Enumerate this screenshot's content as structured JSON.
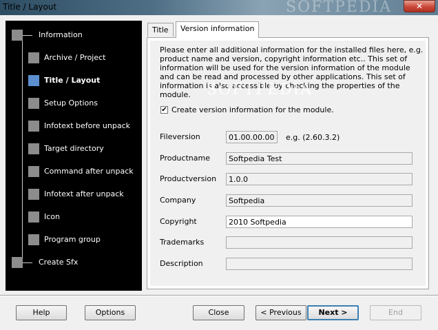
{
  "window": {
    "title": "Title / Layout",
    "watermark": "SOFTPEDIA",
    "close_glyph": "✕"
  },
  "nav": {
    "items": [
      {
        "label": "Information"
      },
      {
        "label": "Archive / Project"
      },
      {
        "label": "Title / Layout"
      },
      {
        "label": "Setup Options"
      },
      {
        "label": "Infotext before unpack"
      },
      {
        "label": "Target directory"
      },
      {
        "label": "Command after unpack"
      },
      {
        "label": "Infotext after unpack"
      },
      {
        "label": "Icon"
      },
      {
        "label": "Program group"
      },
      {
        "label": "Create Sfx"
      }
    ]
  },
  "tabs": [
    {
      "label": "Title"
    },
    {
      "label": "Version information"
    }
  ],
  "panel": {
    "description": "Please enter all additional information for the installed files here, e.g. product name and version, copyright information etc.. This set of information will be used for the version information of the module and can be read and processed by other applications. This set of information is also accessible by checking the properties of the module.",
    "watermark": "SOFTPEDIA",
    "checkbox": {
      "label": "Create version information for the module.",
      "checked": true,
      "mark": "✔"
    },
    "fields": {
      "fileversion": {
        "label": "Fileversion",
        "value": "01.00.00.00",
        "hint": "e.g. (2.60.3.2)"
      },
      "productname": {
        "label": "Productname",
        "value": "Softpedia Test"
      },
      "productversion": {
        "label": "Productversion",
        "value": "1.0.0"
      },
      "company": {
        "label": "Company",
        "value": "Softpedia"
      },
      "copyright": {
        "label": "Copyright",
        "value": "2010 Softpedia"
      },
      "trademarks": {
        "label": "Trademarks",
        "value": ""
      },
      "description": {
        "label": "Description",
        "value": ""
      }
    }
  },
  "buttons": {
    "help": "Help",
    "options": "Options",
    "close": "Close",
    "previous": "< Previous",
    "next": "Next >",
    "end": "End"
  },
  "colors": {
    "active_node": "#5b8fd0",
    "node": "#8c8c8c",
    "nav_bg": "#000000",
    "default_button_border": "#3c7fb1"
  }
}
